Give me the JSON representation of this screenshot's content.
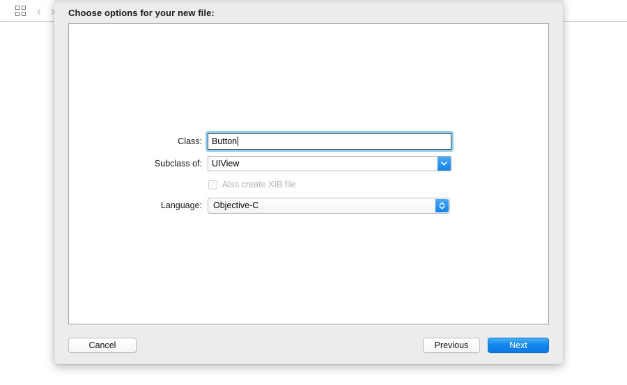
{
  "background_window": {
    "toolbar": {
      "grid_icon": "grid-squares-icon",
      "back_icon": "chevron-left-icon",
      "forward_icon": "chevron-right-icon"
    }
  },
  "sheet": {
    "title": "Choose options for your new file:",
    "form": {
      "class_row": {
        "label": "Class:",
        "value": "Button",
        "placeholder": "",
        "focused": true
      },
      "subclass_row": {
        "label": "Subclass of:",
        "value": "UIView",
        "arrow_icon": "chevron-down-icon"
      },
      "xib_row": {
        "label": "Also create XIB file",
        "checked": false,
        "enabled": false,
        "checkbox_icon": "checkbox-unchecked-icon"
      },
      "language_row": {
        "label": "Language:",
        "value": "Objective-C",
        "arrow_icon": "chevron-up-down-icon"
      }
    },
    "footer": {
      "cancel_label": "Cancel",
      "previous_label": "Previous",
      "next_label": "Next"
    }
  },
  "colors": {
    "accent_blue": "#1186ec",
    "focus_ring_blue": "#7fc8f0",
    "sheet_background": "#ececec",
    "panel_background": "#ffffff",
    "disabled_text": "#b4b4b4"
  }
}
